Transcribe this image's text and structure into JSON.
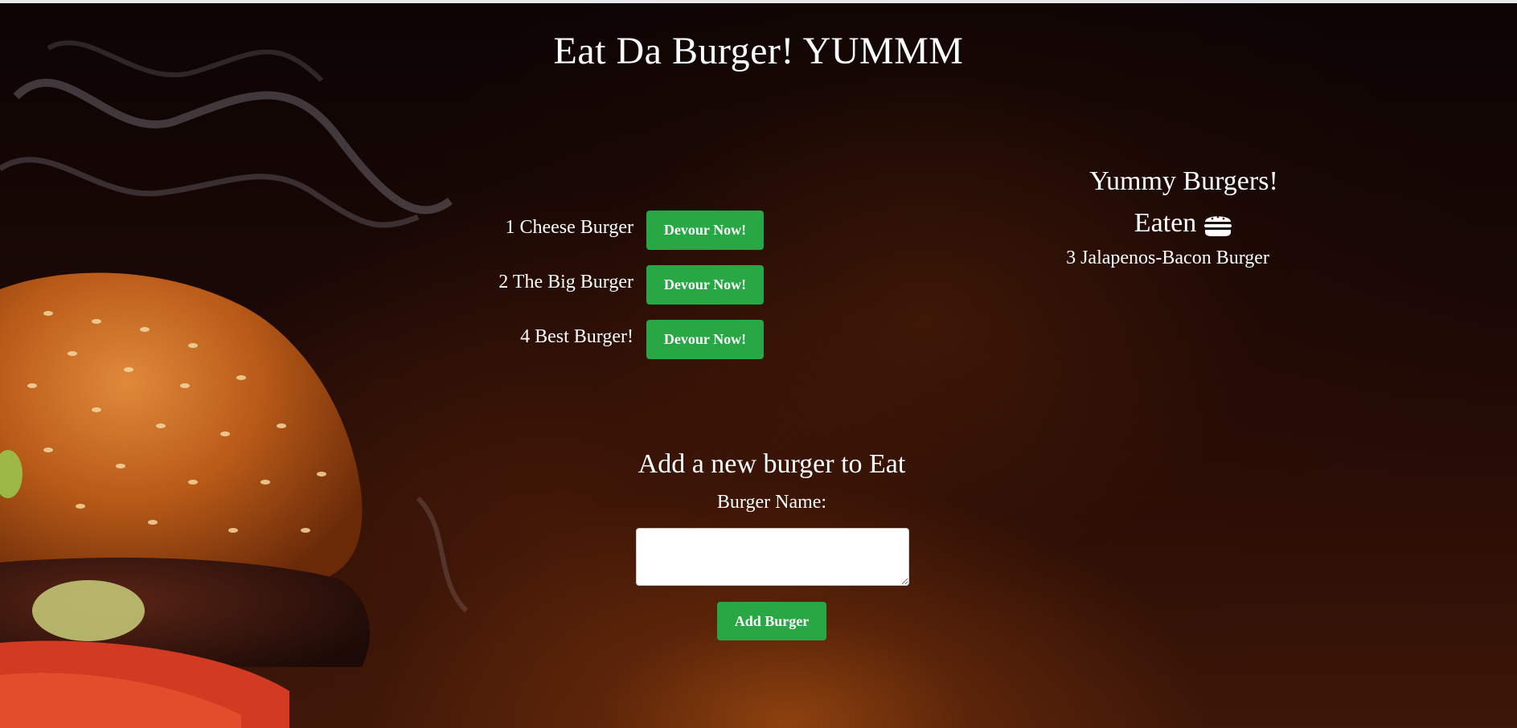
{
  "page": {
    "title": "Eat Da Burger! YUMMM"
  },
  "burgers_to_eat": [
    {
      "label": "1 Cheese Burger",
      "button": "Devour Now!"
    },
    {
      "label": "2 The Big Burger",
      "button": "Devour Now!"
    },
    {
      "label": "4 Best Burger!",
      "button": "Devour Now!"
    }
  ],
  "devoured": {
    "title_line1": "Yummy Burgers!",
    "title_line2": "Eaten",
    "title_icon": "hamburger-icon",
    "items": [
      "3 Jalapenos-Bacon Burger"
    ]
  },
  "add_form": {
    "title": "Add a new burger to Eat",
    "label": "Burger Name:",
    "input_value": "",
    "input_placeholder": "",
    "submit_label": "Add Burger"
  },
  "colors": {
    "button_green": "#28a745",
    "text": "#ffffff",
    "background": "#1a0805"
  }
}
